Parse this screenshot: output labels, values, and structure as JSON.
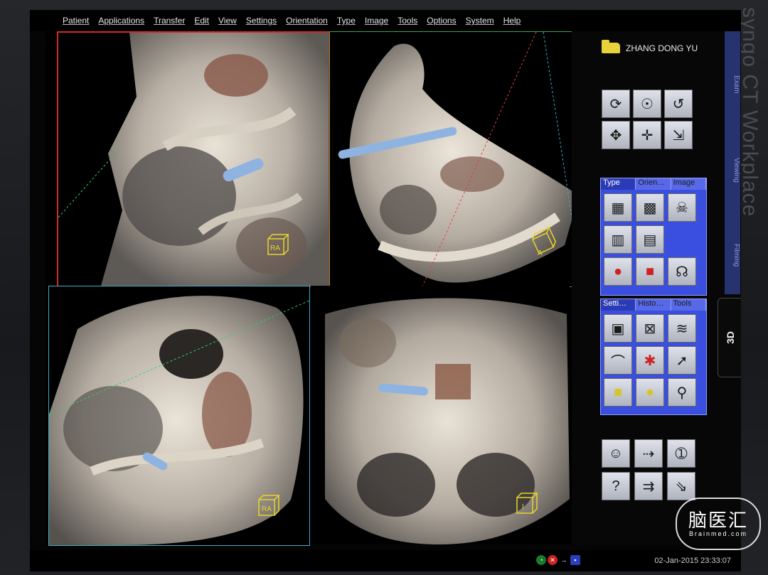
{
  "menu": [
    "Patient",
    "Applications",
    "Transfer",
    "Edit",
    "View",
    "Settings",
    "Orientation",
    "Type",
    "Image",
    "Tools",
    "Options",
    "System",
    "Help"
  ],
  "patient": {
    "name": "ZHANG DONG YU",
    "icon": "folder-icon"
  },
  "side_tabs": [
    "Exam",
    "Viewing",
    "Filming"
  ],
  "active_tab": "3D",
  "type_panel": {
    "tabs": [
      "Type",
      "Orien…",
      "Image"
    ],
    "active": 0
  },
  "settings_panel": {
    "tabs": [
      "Setti…",
      "Histo…",
      "Tools"
    ],
    "active": 0
  },
  "status": {
    "timestamp": "02-Jan-2015 23:33:07"
  },
  "brand": "syngo CT Workplace",
  "watermark": {
    "line1": "脑医汇",
    "line2": "Brainmed.com"
  },
  "orientation_markers": {
    "tl": "RA",
    "tr": "A",
    "bl": "RA",
    "br": "I"
  },
  "colors": {
    "active_viewport": "#d02a2a",
    "viewport_green": "#3aa64a",
    "viewport_cyan": "#3ab1c6",
    "panel_blue": "#3a4fe0",
    "folder_yellow": "#e8d23a"
  }
}
